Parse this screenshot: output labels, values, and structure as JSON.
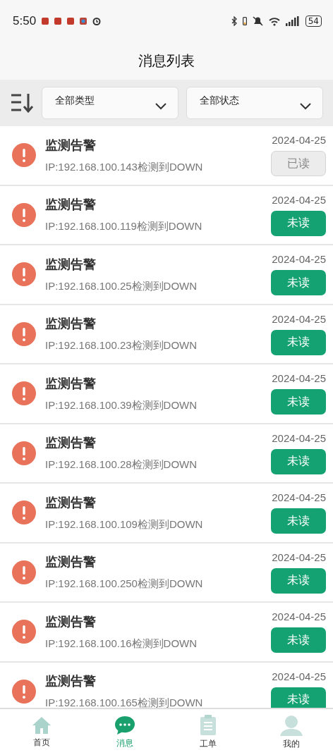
{
  "status_bar": {
    "time": "5:50",
    "battery": "54"
  },
  "header": {
    "title": "消息列表"
  },
  "filters": [
    {
      "label": "全部类型"
    },
    {
      "label": "全部状态"
    }
  ],
  "messages": [
    {
      "title": "监测告警",
      "detail": "IP:192.168.100.143检测到DOWN",
      "date": "2024-04-25",
      "status": "已读",
      "read": true
    },
    {
      "title": "监测告警",
      "detail": "IP:192.168.100.119检测到DOWN",
      "date": "2024-04-25",
      "status": "未读",
      "read": false
    },
    {
      "title": "监测告警",
      "detail": "IP:192.168.100.25检测到DOWN",
      "date": "2024-04-25",
      "status": "未读",
      "read": false
    },
    {
      "title": "监测告警",
      "detail": "IP:192.168.100.23检测到DOWN",
      "date": "2024-04-25",
      "status": "未读",
      "read": false
    },
    {
      "title": "监测告警",
      "detail": "IP:192.168.100.39检测到DOWN",
      "date": "2024-04-25",
      "status": "未读",
      "read": false
    },
    {
      "title": "监测告警",
      "detail": "IP:192.168.100.28检测到DOWN",
      "date": "2024-04-25",
      "status": "未读",
      "read": false
    },
    {
      "title": "监测告警",
      "detail": "IP:192.168.100.109检测到DOWN",
      "date": "2024-04-25",
      "status": "未读",
      "read": false
    },
    {
      "title": "监测告警",
      "detail": "IP:192.168.100.250检测到DOWN",
      "date": "2024-04-25",
      "status": "未读",
      "read": false
    },
    {
      "title": "监测告警",
      "detail": "IP:192.168.100.16检测到DOWN",
      "date": "2024-04-25",
      "status": "未读",
      "read": false
    },
    {
      "title": "监测告警",
      "detail": "IP:192.168.100.165检测到DOWN",
      "date": "2024-04-25",
      "status": "未读",
      "read": false
    }
  ],
  "tab_bar": [
    {
      "label": "首页",
      "kind": "home",
      "selected": false
    },
    {
      "label": "消息",
      "kind": "chat",
      "selected": true
    },
    {
      "label": "工单",
      "kind": "clipboard",
      "selected": false
    },
    {
      "label": "我的",
      "kind": "person",
      "selected": false
    }
  ]
}
